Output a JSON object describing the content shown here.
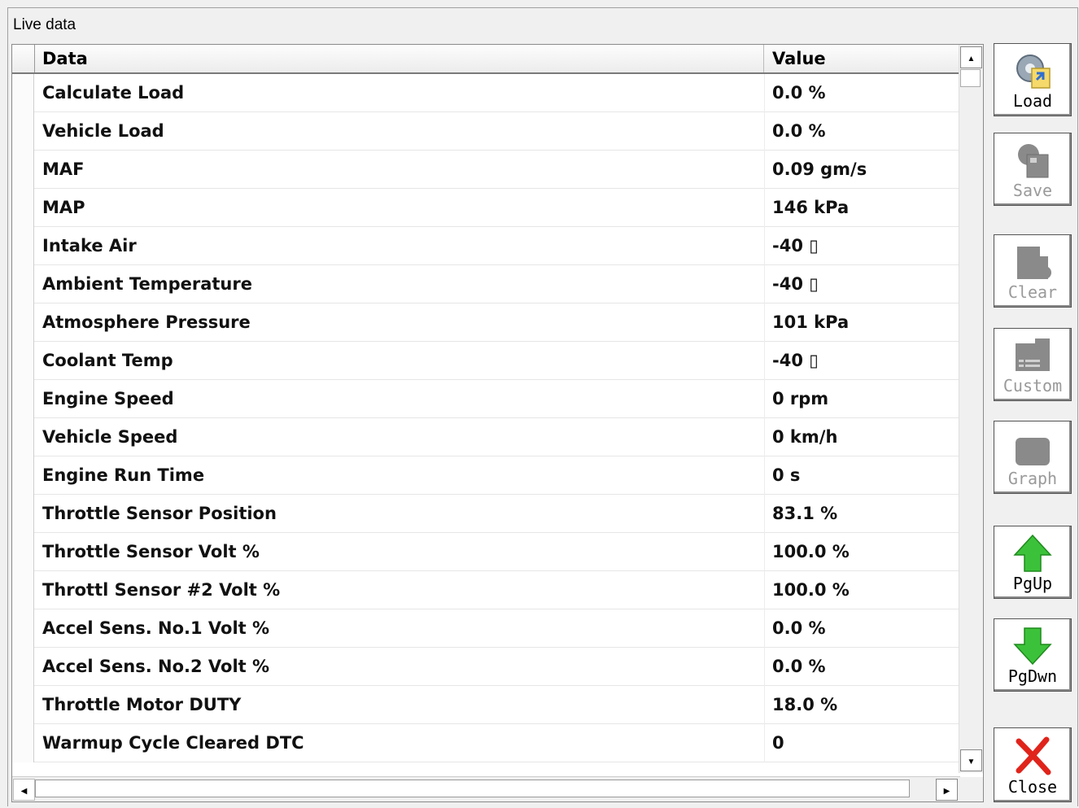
{
  "window": {
    "title": "Live data"
  },
  "table": {
    "columns": [
      "Data",
      "Value"
    ],
    "rows": [
      {
        "name": "Calculate Load",
        "value": "0.0 %"
      },
      {
        "name": "Vehicle Load",
        "value": "0.0 %"
      },
      {
        "name": "MAF",
        "value": "0.09 gm/s"
      },
      {
        "name": "MAP",
        "value": "146 kPa"
      },
      {
        "name": "Intake Air",
        "value": "-40 ▯"
      },
      {
        "name": "Ambient Temperature",
        "value": "-40 ▯"
      },
      {
        "name": "Atmosphere Pressure",
        "value": "101 kPa"
      },
      {
        "name": "Coolant Temp",
        "value": "-40 ▯"
      },
      {
        "name": "Engine Speed",
        "value": "0 rpm"
      },
      {
        "name": "Vehicle Speed",
        "value": "0 km/h"
      },
      {
        "name": "Engine Run Time",
        "value": "0 s"
      },
      {
        "name": "Throttle Sensor Position",
        "value": "83.1 %"
      },
      {
        "name": "Throttle Sensor Volt %",
        "value": "100.0 %"
      },
      {
        "name": "Throttl Sensor #2 Volt %",
        "value": "100.0 %"
      },
      {
        "name": "Accel Sens. No.1 Volt %",
        "value": "0.0 %"
      },
      {
        "name": "Accel Sens. No.2 Volt %",
        "value": "0.0 %"
      },
      {
        "name": "Throttle Motor DUTY",
        "value": "18.0 %"
      },
      {
        "name": "Warmup Cycle Cleared DTC",
        "value": "0"
      }
    ]
  },
  "scrollbar": {
    "up_arrow": "▲",
    "down_arrow": "▼",
    "left_arrow": "◀",
    "right_arrow": "▶"
  },
  "toolbar": {
    "buttons": [
      {
        "label": "Load",
        "icon": "load-icon",
        "enabled": true
      },
      {
        "label": "Save",
        "icon": "save-icon",
        "enabled": false
      },
      {
        "label": "Clear",
        "icon": "clear-icon",
        "enabled": false
      },
      {
        "label": "Custom",
        "icon": "custom-icon",
        "enabled": false
      },
      {
        "label": "Graph",
        "icon": "graph-icon",
        "enabled": false
      },
      {
        "label": "PgUp",
        "icon": "arrow-up-icon",
        "enabled": true
      },
      {
        "label": "PgDwn",
        "icon": "arrow-down-icon",
        "enabled": true
      },
      {
        "label": "Close",
        "icon": "close-icon",
        "enabled": true
      }
    ]
  },
  "colors": {
    "arrow_green": "#3cc23a",
    "close_red": "#e0241b",
    "disabled_icon": "#8a8a8a"
  }
}
